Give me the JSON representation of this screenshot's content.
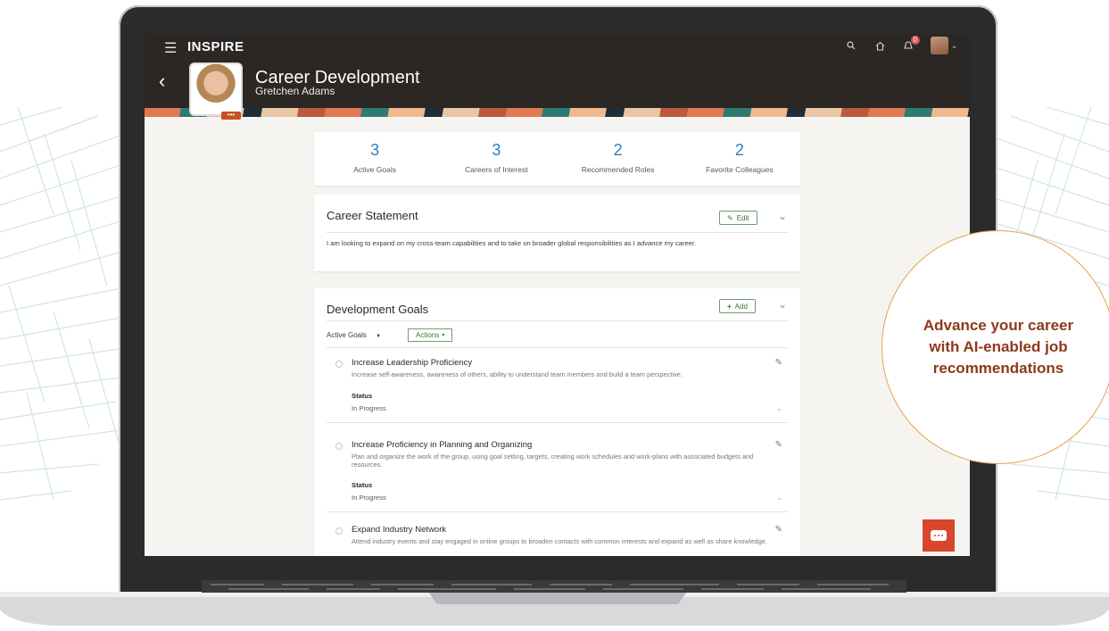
{
  "app": {
    "brand": "INSPIRE",
    "notification_count": "0"
  },
  "header": {
    "title": "Career Development",
    "subtitle": "Gretchen Adams"
  },
  "stats": [
    {
      "value": "3",
      "label": "Active Goals"
    },
    {
      "value": "3",
      "label": "Careers of Interest"
    },
    {
      "value": "2",
      "label": "Recommended Roles"
    },
    {
      "value": "2",
      "label": "Favorite Colleagues"
    }
  ],
  "career_statement": {
    "title": "Career Statement",
    "edit_label": "Edit",
    "text": "I am looking to expand on my cross-team capabilities and to take on broader global responsibilities as I advance my career."
  },
  "development_goals": {
    "title": "Development Goals",
    "add_label": "Add",
    "filter_value": "Active Goals",
    "actions_label": "Actions",
    "status_label": "Status",
    "goals": [
      {
        "title": "Increase Leadership Proficiency",
        "description": "Increase self-awareness, awareness of others, ability to understand team members and build a team perspective.",
        "status": "In Progress"
      },
      {
        "title": "Increase Proficiency in Planning and Organizing",
        "description": "Plan and organize the work of the group, using goal setting, targets, creating work schedules and work-plans with associated budgets and resources.",
        "status": "In Progress"
      },
      {
        "title": "Expand Industry Network",
        "description": "Attend industry events and stay engaged in online groups to broaden contacts with common interests and expand as well as share knowledge."
      }
    ]
  },
  "promo": {
    "text": "Advance your career with AI-enabled job recommendations"
  },
  "colors": {
    "accent": "#2f7fc1",
    "header_bg": "#2a2725",
    "chat": "#d9462e",
    "promo_text": "#8b3a1a",
    "promo_border": "#e5a34a"
  }
}
